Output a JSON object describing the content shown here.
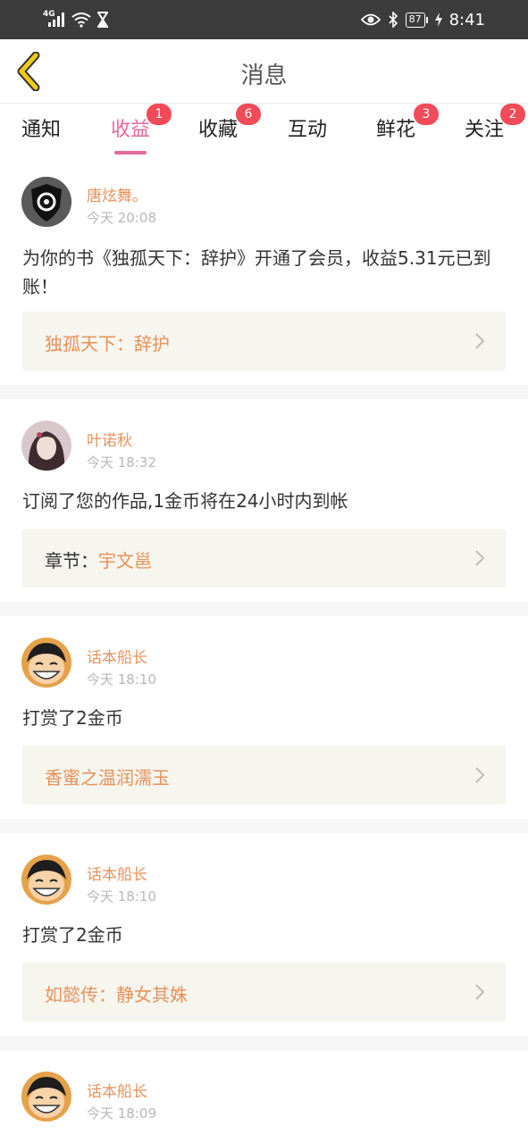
{
  "status_bar": {
    "network": "4G",
    "battery": "87",
    "time": "8:41"
  },
  "header": {
    "title": "消息"
  },
  "tabs": [
    {
      "label": "通知",
      "badge": ""
    },
    {
      "label": "收益",
      "badge": "1",
      "active": true
    },
    {
      "label": "收藏",
      "badge": "6"
    },
    {
      "label": "互动",
      "badge": ""
    },
    {
      "label": "鲜花",
      "badge": "3"
    },
    {
      "label": "关注",
      "badge": "2"
    }
  ],
  "messages": [
    {
      "user": "唐炫舞。",
      "time": "今天 20:08",
      "text": "为你的书《独孤天下：辞护》开通了会员，收益5.31元已到账！",
      "link_prefix": "",
      "link": "独孤天下：辞护",
      "avatar": "shield-avatar"
    },
    {
      "user": "叶诺秋",
      "time": "今天 18:32",
      "text": "订阅了您的作品,1金币将在24小时内到帐",
      "link_prefix": "章节：",
      "link": "宇文邕",
      "avatar": "girl-avatar"
    },
    {
      "user": "话本船长",
      "time": "今天 18:10",
      "text": "打赏了2金币",
      "link_prefix": "",
      "link": "香蜜之温润濡玉",
      "avatar": "cartoon-avatar"
    },
    {
      "user": "话本船长",
      "time": "今天 18:10",
      "text": "打赏了2金币",
      "link_prefix": "",
      "link": "如懿传：静女其姝",
      "avatar": "cartoon-avatar"
    },
    {
      "user": "话本船长",
      "time": "今天 18:09",
      "text": "",
      "link_prefix": "",
      "link": "",
      "avatar": "cartoon-avatar"
    }
  ],
  "colors": {
    "accent": "#e46a9a",
    "badge": "#f24a58",
    "name": "#e8925a",
    "back_icon": "#e8c200"
  }
}
